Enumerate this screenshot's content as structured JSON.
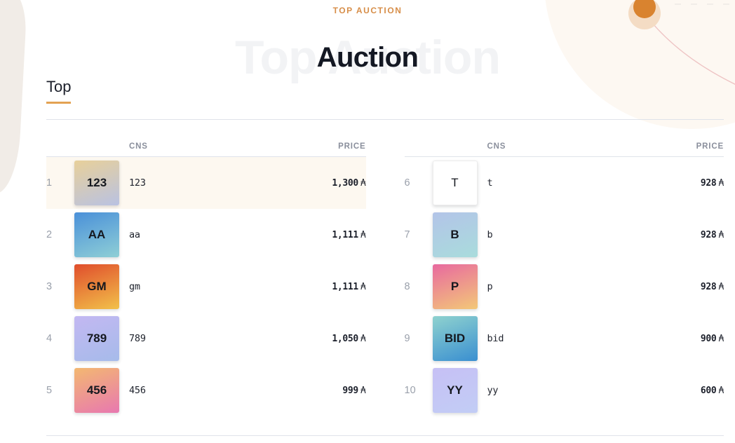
{
  "header": {
    "eyebrow": "TOP AUCTION",
    "ghost_title": "Top Auction",
    "title": "Auction",
    "accent_color": "#d78e49",
    "ghost_color": "#f2f3f5"
  },
  "tabs": [
    {
      "label": "Top",
      "active": true
    }
  ],
  "columns": {
    "rank": "",
    "cns": "CNS",
    "price": "PRICE"
  },
  "currency_symbol": "₳",
  "tables": [
    {
      "name": "left-table",
      "rows": [
        {
          "rank": "1",
          "tile_label": "123",
          "cns": "123",
          "price": "1,300",
          "highlight": true,
          "gradient_from": "#e8d09a",
          "gradient_to": "#b9c2e2"
        },
        {
          "rank": "2",
          "tile_label": "AA",
          "cns": "aa",
          "price": "1,111",
          "highlight": false,
          "gradient_from": "#4a90d9",
          "gradient_to": "#8fcfd6"
        },
        {
          "rank": "3",
          "tile_label": "GM",
          "cns": "gm",
          "price": "1,111",
          "highlight": false,
          "gradient_from": "#e04d2c",
          "gradient_to": "#f2c14a"
        },
        {
          "rank": "4",
          "tile_label": "789",
          "cns": "789",
          "price": "1,050",
          "highlight": false,
          "gradient_from": "#c3b8f2",
          "gradient_to": "#a6bbea"
        },
        {
          "rank": "5",
          "tile_label": "456",
          "cns": "456",
          "price": "999",
          "highlight": false,
          "gradient_from": "#f3b871",
          "gradient_to": "#e878b0"
        }
      ]
    },
    {
      "name": "right-table",
      "rows": [
        {
          "rank": "6",
          "tile_label": "T",
          "cns": "t",
          "price": "928",
          "highlight": false,
          "gradient_from": "#ffffff",
          "gradient_to": "#ffffff",
          "plain": true
        },
        {
          "rank": "7",
          "tile_label": "B",
          "cns": "b",
          "price": "928",
          "highlight": false,
          "gradient_from": "#b3c4e8",
          "gradient_to": "#a9dcdc"
        },
        {
          "rank": "8",
          "tile_label": "P",
          "cns": "p",
          "price": "928",
          "highlight": false,
          "gradient_from": "#e8699f",
          "gradient_to": "#f3c878"
        },
        {
          "rank": "9",
          "tile_label": "BID",
          "cns": "bid",
          "price": "900",
          "highlight": false,
          "gradient_from": "#8fd2cf",
          "gradient_to": "#3a8fd0"
        },
        {
          "rank": "10",
          "tile_label": "YY",
          "cns": "yy",
          "price": "600",
          "highlight": false,
          "gradient_from": "#c6c0f5",
          "gradient_to": "#c2cdf5"
        }
      ]
    }
  ]
}
